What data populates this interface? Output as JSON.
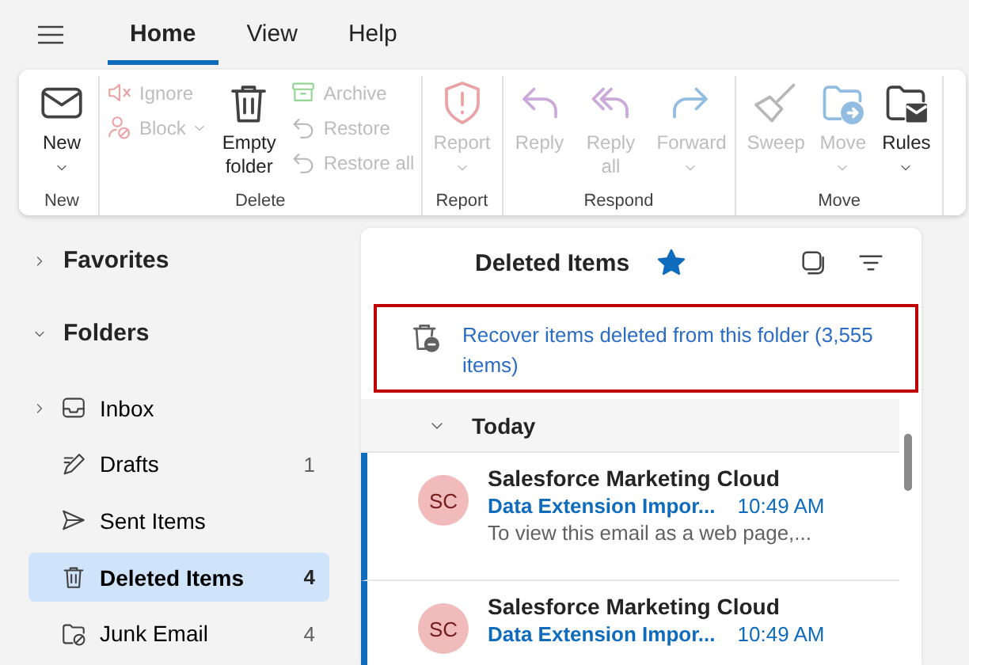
{
  "tabs": [
    {
      "label": "Home",
      "selected": true
    },
    {
      "label": "View",
      "selected": false
    },
    {
      "label": "Help",
      "selected": false
    }
  ],
  "ribbon": {
    "groups": [
      {
        "label": "New",
        "items": [
          {
            "kind": "large",
            "label": "New",
            "disabled": false,
            "dropdown": true
          }
        ]
      },
      {
        "label": "Delete",
        "items": [
          {
            "kind": "small",
            "label": "Ignore",
            "disabled": true,
            "dropdown": false
          },
          {
            "kind": "small",
            "label": "Block",
            "disabled": true,
            "dropdown": true
          },
          {
            "kind": "large",
            "label": "Empty folder",
            "disabled": false,
            "dropdown": false
          },
          {
            "kind": "small",
            "label": "Archive",
            "disabled": true,
            "dropdown": false
          },
          {
            "kind": "small",
            "label": "Restore",
            "disabled": true,
            "dropdown": false
          },
          {
            "kind": "small",
            "label": "Restore all",
            "disabled": true,
            "dropdown": false
          }
        ]
      },
      {
        "label": "Report",
        "items": [
          {
            "kind": "large",
            "label": "Report",
            "disabled": true,
            "dropdown": true
          }
        ]
      },
      {
        "label": "Respond",
        "items": [
          {
            "kind": "large",
            "label": "Reply",
            "disabled": true,
            "dropdown": false
          },
          {
            "kind": "large",
            "label": "Reply all",
            "disabled": true,
            "dropdown": false
          },
          {
            "kind": "large",
            "label": "Forward",
            "disabled": true,
            "dropdown": true
          }
        ]
      },
      {
        "label": "Move",
        "items": [
          {
            "kind": "large",
            "label": "Sweep",
            "disabled": true,
            "dropdown": false
          },
          {
            "kind": "large",
            "label": "Move",
            "disabled": true,
            "dropdown": true
          },
          {
            "kind": "large",
            "label": "Rules",
            "disabled": false,
            "dropdown": true
          }
        ]
      }
    ]
  },
  "folder_pane": {
    "sections": [
      {
        "label": "Favorites",
        "expanded": false
      },
      {
        "label": "Folders",
        "expanded": true,
        "items": [
          {
            "label": "Inbox",
            "selected": false,
            "expanded": false
          },
          {
            "label": "Drafts",
            "count": "1",
            "selected": false
          },
          {
            "label": "Sent Items",
            "selected": false
          },
          {
            "label": "Deleted Items",
            "count": "4",
            "selected": true
          },
          {
            "label": "Junk Email",
            "count": "4",
            "selected": false
          }
        ]
      }
    ]
  },
  "message_list": {
    "title": "Deleted Items",
    "favorite": true,
    "recover_link": "Recover items deleted from this folder (3,555 items)",
    "groups": [
      {
        "label": "Today",
        "expanded": true,
        "messages": [
          {
            "initials": "SC",
            "sender": "Salesforce Marketing Cloud",
            "subject": "Data Extension Impor...",
            "time": "10:49 AM",
            "preview": "To view this email as a web page,...",
            "unread": true
          },
          {
            "initials": "SC",
            "sender": "Salesforce Marketing Cloud",
            "subject": "Data Extension Impor...",
            "time": "10:49 AM",
            "unread": true
          }
        ]
      }
    ]
  }
}
